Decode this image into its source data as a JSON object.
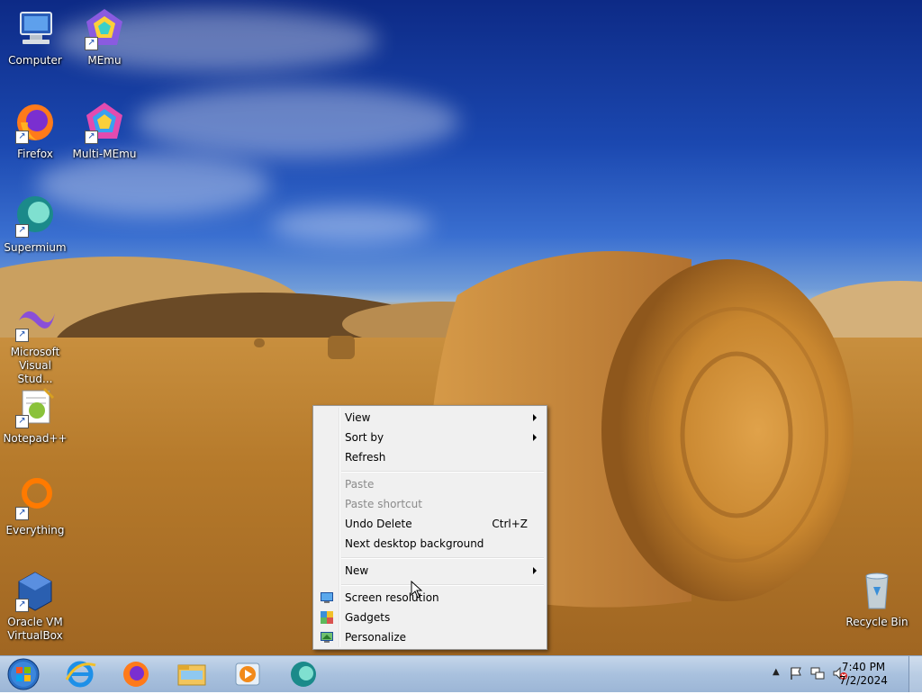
{
  "desktop": {
    "icons": [
      {
        "label": "Computer",
        "icon": "computer-icon"
      },
      {
        "label": "MEmu",
        "icon": "memu-icon"
      },
      {
        "label": "Firefox",
        "icon": "firefox-icon"
      },
      {
        "label": "Multi-MEmu",
        "icon": "multi-memu-icon"
      },
      {
        "label": "Supermium",
        "icon": "supermium-icon"
      },
      {
        "label": "Microsoft Visual Stud...",
        "icon": "visual-studio-icon"
      },
      {
        "label": "Notepad++",
        "icon": "notepadpp-icon"
      },
      {
        "label": "Everything",
        "icon": "everything-icon"
      },
      {
        "label": "Oracle VM VirtualBox",
        "icon": "virtualbox-icon"
      },
      {
        "label": "Recycle Bin",
        "icon": "recycle-bin-icon"
      }
    ]
  },
  "context_menu": {
    "items": [
      {
        "label": "View",
        "submenu": true
      },
      {
        "label": "Sort by",
        "submenu": true
      },
      {
        "label": "Refresh"
      },
      {
        "label": "Paste",
        "disabled": true
      },
      {
        "label": "Paste shortcut",
        "disabled": true
      },
      {
        "label": "Undo Delete",
        "shortcut": "Ctrl+Z"
      },
      {
        "label": "Next desktop background"
      },
      {
        "label": "New",
        "submenu": true
      },
      {
        "label": "Screen resolution",
        "icon": "screen-resolution-icon"
      },
      {
        "label": "Gadgets",
        "icon": "gadgets-icon"
      },
      {
        "label": "Personalize",
        "icon": "personalize-icon"
      }
    ]
  },
  "taskbar": {
    "pinned": [
      "internet-explorer-icon",
      "firefox-icon",
      "file-explorer-icon",
      "media-player-icon",
      "supermium-icon"
    ],
    "tray_icons": [
      "show-hidden-icons-icon",
      "action-center-flag-icon",
      "network-icon",
      "volume-muted-icon"
    ],
    "clock": {
      "time": "7:40 PM",
      "date": "7/2/2024"
    }
  }
}
